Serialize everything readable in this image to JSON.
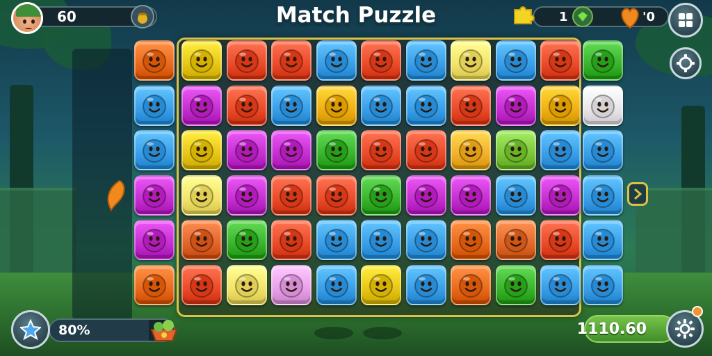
{
  "header": {
    "title": "Match Puzzle",
    "player_value": "60",
    "left_icon": "acorn-icon",
    "right_value_1": "1",
    "right_value_2": "'0",
    "menu_icon": "grid-menu-icon",
    "settings_icon": "gear-icon"
  },
  "footer": {
    "progress_text": "80%",
    "progress_fraction": 0.8,
    "score_text": "1110.60",
    "star_icon": "star-icon",
    "gear_icon": "gear-icon"
  },
  "colors": {
    "board_border": "#d9c24a",
    "accent_green": "#6bbf45",
    "accent_orange": "#f09432"
  },
  "board": {
    "rows": [
      [
        "#e8c617",
        "#ea4b2a",
        "#ea4b2a",
        "#3a9ee8",
        "#ea4b2a",
        "#3a9ee8",
        "#f3e36a",
        "#3a9ee8",
        "#ea4b2a"
      ],
      [
        "#c52fd0",
        "#ea4b2a",
        "#3a9ee8",
        "#f0b012",
        "#3a9ee8",
        "#3a9ee8",
        "#ea4b2a",
        "#c52fd0",
        "#f0b012"
      ],
      [
        "#e8c617",
        "#c52fd0",
        "#c52fd0",
        "#3ab32d",
        "#ea4b2a",
        "#ea4b2a",
        "#f3b12a",
        "#7cc63b",
        "#3a9ee8"
      ],
      [
        "#f3e36a",
        "#c52fd0",
        "#ea4b2a",
        "#ea4b2a",
        "#3ab32d",
        "#c52fd0",
        "#c52fd0",
        "#3a9ee8",
        "#c52fd0"
      ],
      [
        "#e2652b",
        "#3ab32d",
        "#ea4b2a",
        "#3a9ee8",
        "#3a9ee8",
        "#3a9ee8",
        "#ea6a1d",
        "#e26a2b",
        "#ea4b2a"
      ],
      [
        "#ea4b2a",
        "#f3e36a",
        "#e8a0e8",
        "#3a9ee8",
        "#e8c617",
        "#3a9ee8",
        "#ea6a1d",
        "#3ab32d",
        "#3a9ee8"
      ]
    ],
    "left_column": [
      "#ea6a1d",
      "#3a9ee8",
      "#3a9ee8",
      "#c52fd0",
      "#c52fd0",
      "#ea6a1d"
    ],
    "right_column": [
      "#3ab32d",
      "#e8e6ea",
      "#3a9ee8",
      "#3a9ee8",
      "#3a9ee8",
      "#3a9ee8"
    ]
  }
}
